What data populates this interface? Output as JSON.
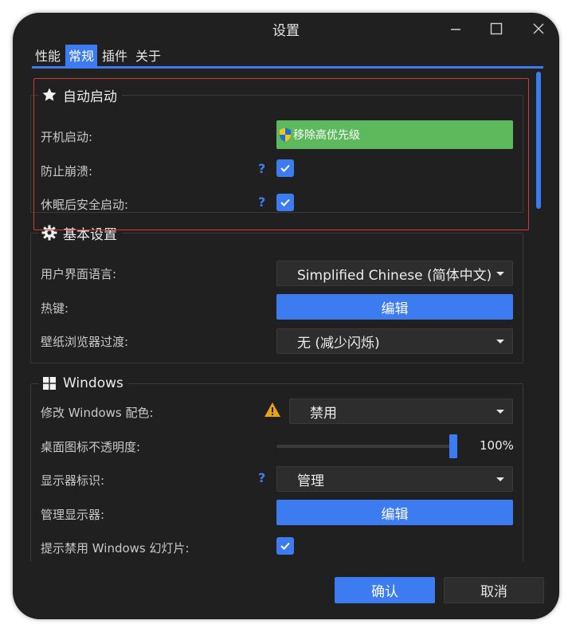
{
  "window": {
    "title": "设置"
  },
  "tabs": [
    {
      "label": "性能"
    },
    {
      "label": "常规"
    },
    {
      "label": "插件"
    },
    {
      "label": "关于"
    }
  ],
  "autostart": {
    "title": "自动启动",
    "icon": "star-icon",
    "boot_label": "开机启动:",
    "boot_button": "移除高优先级",
    "crash_label": "防止崩溃:",
    "crash_checked": true,
    "sleep_label": "休眠后安全启动:",
    "sleep_checked": true,
    "help": "?"
  },
  "basic": {
    "title": "基本设置",
    "icon": "gear-icon",
    "language_label": "用户界面语言:",
    "language_value": "Simplified Chinese (简体中文)",
    "hotkey_label": "热键:",
    "hotkey_button": "编辑",
    "transition_label": "壁纸浏览器过渡:",
    "transition_value": "无 (减少闪烁)"
  },
  "windows": {
    "title": "Windows",
    "icon": "windows-logo-icon",
    "color_label": "修改 Windows 配色:",
    "color_value": "禁用",
    "opacity_label": "桌面图标不透明度:",
    "opacity_value": "100%",
    "opacity_fraction": 1.0,
    "monitor_id_label": "显示器标识:",
    "monitor_id_value": "管理",
    "manage_monitors_label": "管理显示器:",
    "manage_monitors_button": "编辑",
    "slideshow_label": "提示禁用 Windows 幻灯片:",
    "slideshow_checked": true,
    "help": "?"
  },
  "footer": {
    "ok": "确认",
    "cancel": "取消"
  },
  "colors": {
    "accent": "#3d7bf0",
    "green": "#5cba5c",
    "background": "#202020",
    "highlight": "#d23a3a",
    "warning": "#e8a317"
  }
}
